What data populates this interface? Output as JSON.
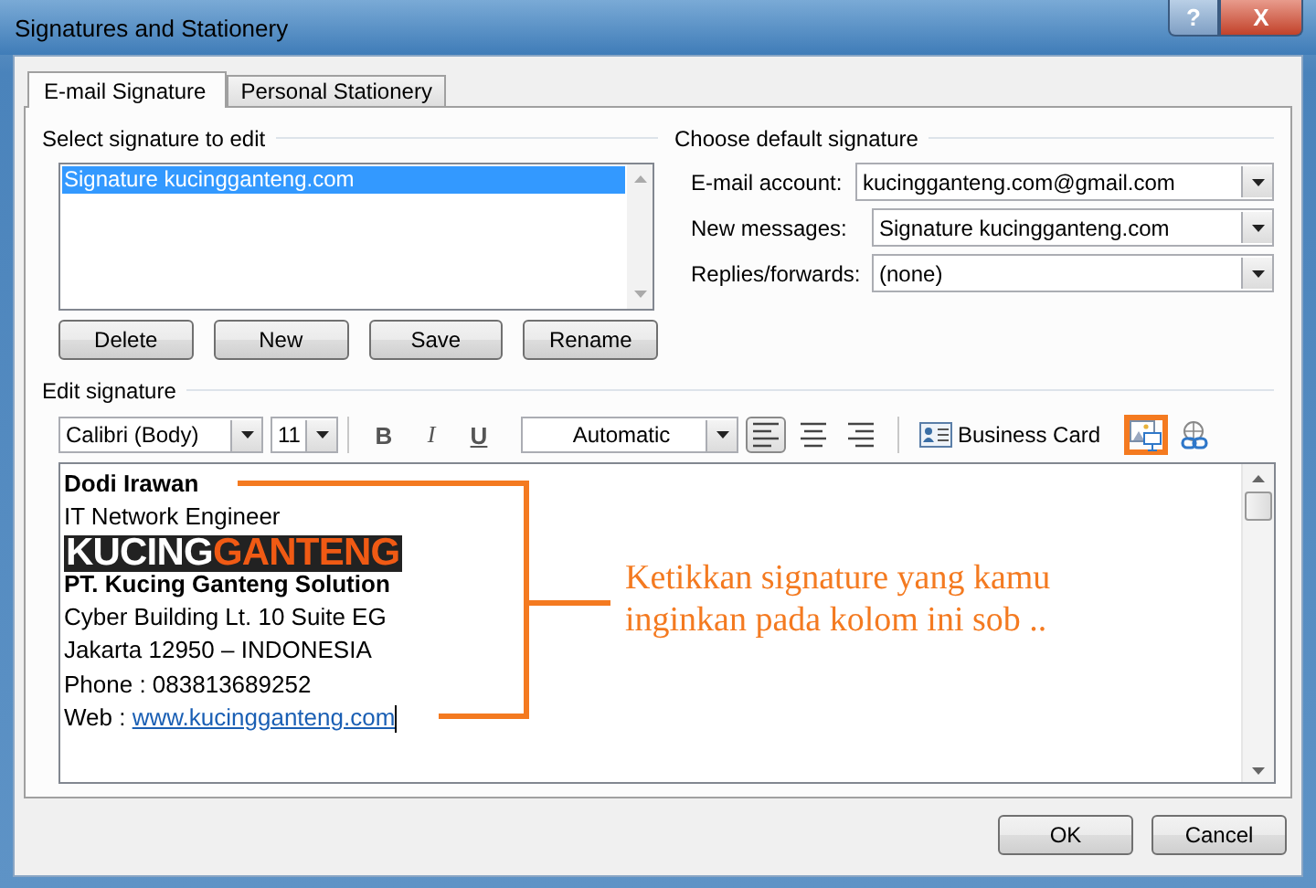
{
  "window": {
    "title": "Signatures and Stationery",
    "controls": [
      {
        "kind": "help",
        "label": "?"
      },
      {
        "kind": "close",
        "label": "X"
      }
    ]
  },
  "tabs": [
    {
      "label": "E-mail Signature",
      "selected": true
    },
    {
      "label": "Personal Stationery",
      "selected": false
    }
  ],
  "select_signature": {
    "label": "Select signature to edit",
    "items": [
      {
        "label": "Signature kucingganteng.com",
        "selected": true
      }
    ],
    "buttons": [
      "Delete",
      "New",
      "Save",
      "Rename"
    ]
  },
  "default_signature": {
    "label": "Choose default signature",
    "fields": [
      {
        "label": "E-mail account:",
        "value": "kucingganteng.com@gmail.com"
      },
      {
        "label": "New messages:",
        "value": "Signature kucingganteng.com"
      },
      {
        "label": "Replies/forwards:",
        "value": "(none)"
      }
    ]
  },
  "edit_signature": {
    "label": "Edit signature",
    "font": "Calibri (Body)",
    "size": "11",
    "format_buttons": [
      "B",
      "I",
      "U"
    ],
    "font_color_label": "Automatic",
    "alignment": [
      {
        "kind": "left",
        "selected": true
      },
      {
        "kind": "center",
        "selected": false
      },
      {
        "kind": "right",
        "selected": false
      }
    ],
    "business_card": "Business Card",
    "insert_buttons": [
      {
        "kind": "picture",
        "highlighted": true
      },
      {
        "kind": "hyperlink",
        "highlighted": false
      }
    ],
    "lines": [
      {
        "kind": "bold",
        "text": "Dodi Irawan"
      },
      {
        "kind": "plain",
        "text": "IT Network Engineer"
      },
      {
        "kind": "logo",
        "text": "KUCING",
        "accent": "GANTENG"
      },
      {
        "kind": "bold",
        "text": "PT. Kucing Ganteng Solution"
      },
      {
        "kind": "plain",
        "text": "Cyber Building Lt. 10 Suite EG"
      },
      {
        "kind": "plain",
        "text": "Jakarta 12950 – INDONESIA"
      },
      {
        "kind": "plain",
        "text": "Phone : 083813689252"
      },
      {
        "kind": "web",
        "text": "Web : ",
        "link": "www.kucingganteng.com"
      }
    ]
  },
  "annotation": {
    "lines": [
      "Ketikkan signature yang kamu",
      "inginkan pada kolom ini sob .."
    ]
  },
  "buttons": [
    "OK",
    "Cancel"
  ]
}
